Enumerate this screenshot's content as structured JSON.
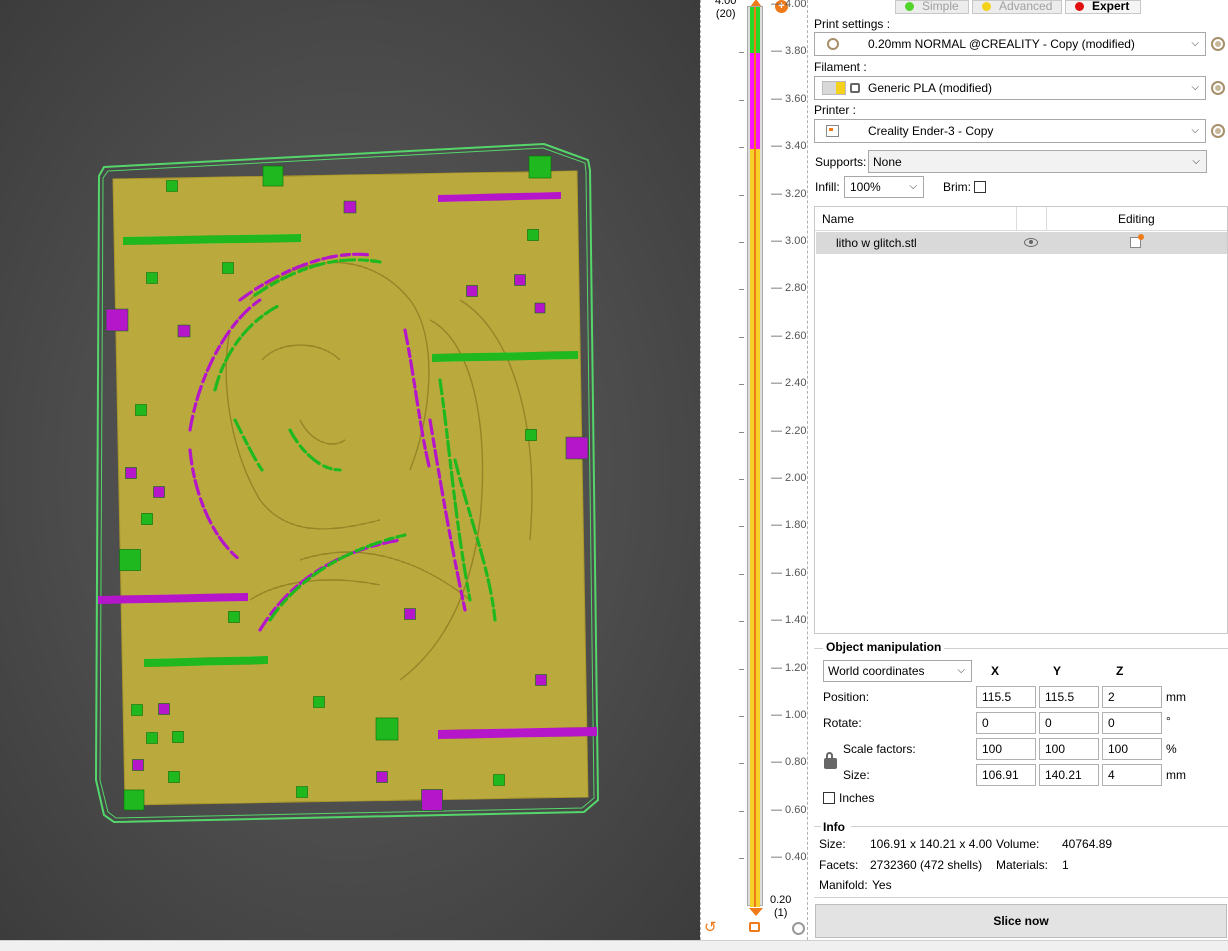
{
  "colors": {
    "viewport_bg": "#4c4c4c",
    "plate_fill": "#c9b84a",
    "plate_stroke": "#a8962a",
    "skirt": "#55d66a",
    "green_feature": "#1fb81f",
    "magenta_feature": "#b516c9",
    "slider_yellow": "#f7d02a",
    "slider_magenta": "#ff14ff",
    "slider_green": "#28d828",
    "accent_orange": "#ee7a1a"
  },
  "slider": {
    "top_value": "4.00",
    "top_layer": "(20)",
    "bottom_value": "0.20",
    "bottom_layer": "(1)",
    "ticks": [
      "4.00",
      "3.80",
      "3.60",
      "3.40",
      "3.20",
      "3.00",
      "2.80",
      "2.60",
      "2.40",
      "2.20",
      "2.00",
      "1.80",
      "1.60",
      "1.40",
      "1.20",
      "1.00",
      "0.80",
      "0.60",
      "0.40"
    ]
  },
  "modes": {
    "simple": "Simple",
    "advanced": "Advanced",
    "expert": "Expert"
  },
  "print_settings": {
    "label": "Print settings :",
    "value": "0.20mm NORMAL @CREALITY - Copy (modified)"
  },
  "filament": {
    "label": "Filament :",
    "value": "Generic PLA (modified)"
  },
  "printer": {
    "label": "Printer :",
    "value": "Creality Ender-3 - Copy"
  },
  "supports": {
    "label": "Supports:",
    "value": "None"
  },
  "infill": {
    "label": "Infill:",
    "value": "100%"
  },
  "brim": {
    "label": "Brim:",
    "checked": false
  },
  "object_list": {
    "col_name": "Name",
    "col_editing": "Editing",
    "items": [
      {
        "name": "litho w glitch.stl"
      }
    ]
  },
  "object_manipulation": {
    "title": "Object manipulation",
    "coord_system": "World coordinates",
    "axes": [
      "X",
      "Y",
      "Z"
    ],
    "rows": [
      {
        "label": "Position:",
        "values": [
          "115.5",
          "115.5",
          "2"
        ],
        "unit": "mm"
      },
      {
        "label": "Rotate:",
        "values": [
          "0",
          "0",
          "0"
        ],
        "unit": "°"
      },
      {
        "label": "Scale factors:",
        "values": [
          "100",
          "100",
          "100"
        ],
        "unit": "%"
      },
      {
        "label": "Size:",
        "values": [
          "106.91",
          "140.21",
          "4"
        ],
        "unit": "mm"
      }
    ],
    "inches_label": "Inches",
    "inches_checked": false
  },
  "info": {
    "title": "Info",
    "size_label": "Size:",
    "size_value": "106.91 x 140.21 x 4.00",
    "volume_label": "Volume:",
    "volume_value": "40764.89",
    "facets_label": "Facets:",
    "facets_value": "2732360 (472 shells)",
    "materials_label": "Materials:",
    "materials_value": "1",
    "manifold_label": "Manifold:",
    "manifold_value": "Yes"
  },
  "slice_button": "Slice now"
}
